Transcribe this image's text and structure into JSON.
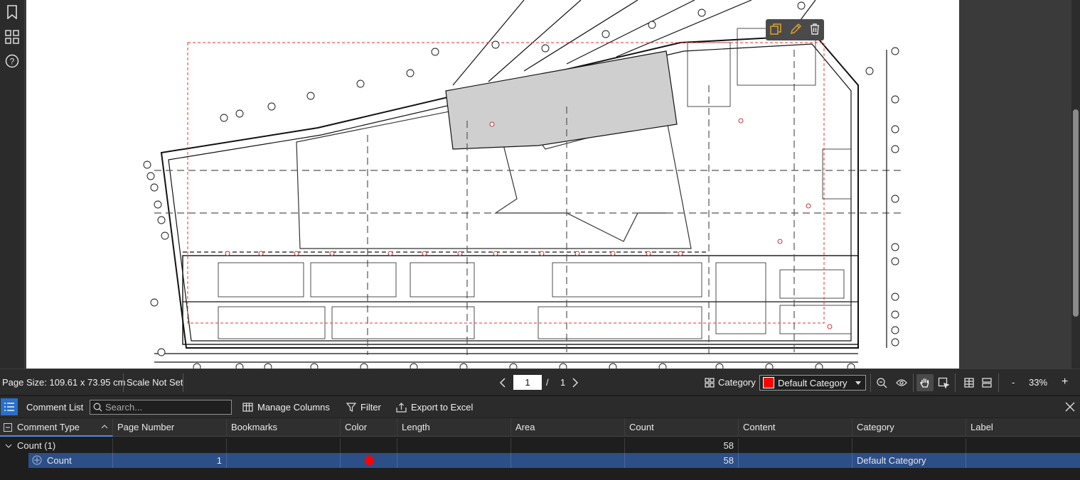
{
  "viewer": {
    "page_number": "1",
    "page_total": "1",
    "page_separator": "/"
  },
  "status": {
    "page_size": "Page Size: 109.61 x 73.95 cm",
    "scale": "Scale Not Set",
    "category_label": "Category",
    "category_value": "Default Category",
    "category_color": "#ff0000",
    "zoom_minus": "-",
    "zoom": "33%",
    "zoom_plus": "+"
  },
  "comments": {
    "title": "Comment List",
    "search_placeholder": "Search...",
    "manage_columns": "Manage Columns",
    "filter": "Filter",
    "export": "Export to Excel",
    "columns": [
      "Comment Type",
      "Page Number",
      "Bookmarks",
      "Color",
      "Length",
      "Area",
      "Count",
      "Content",
      "Category",
      "Label"
    ],
    "group": {
      "label": "Count (1)",
      "count": "58"
    },
    "rows": [
      {
        "type": "Count",
        "page": "1",
        "color": "#ff0000",
        "count": "58",
        "category": "Default Category"
      }
    ]
  },
  "colors": {
    "accent": "#2c4f88",
    "markup_red": "#ff0000",
    "panel": "#2b2b2b"
  }
}
